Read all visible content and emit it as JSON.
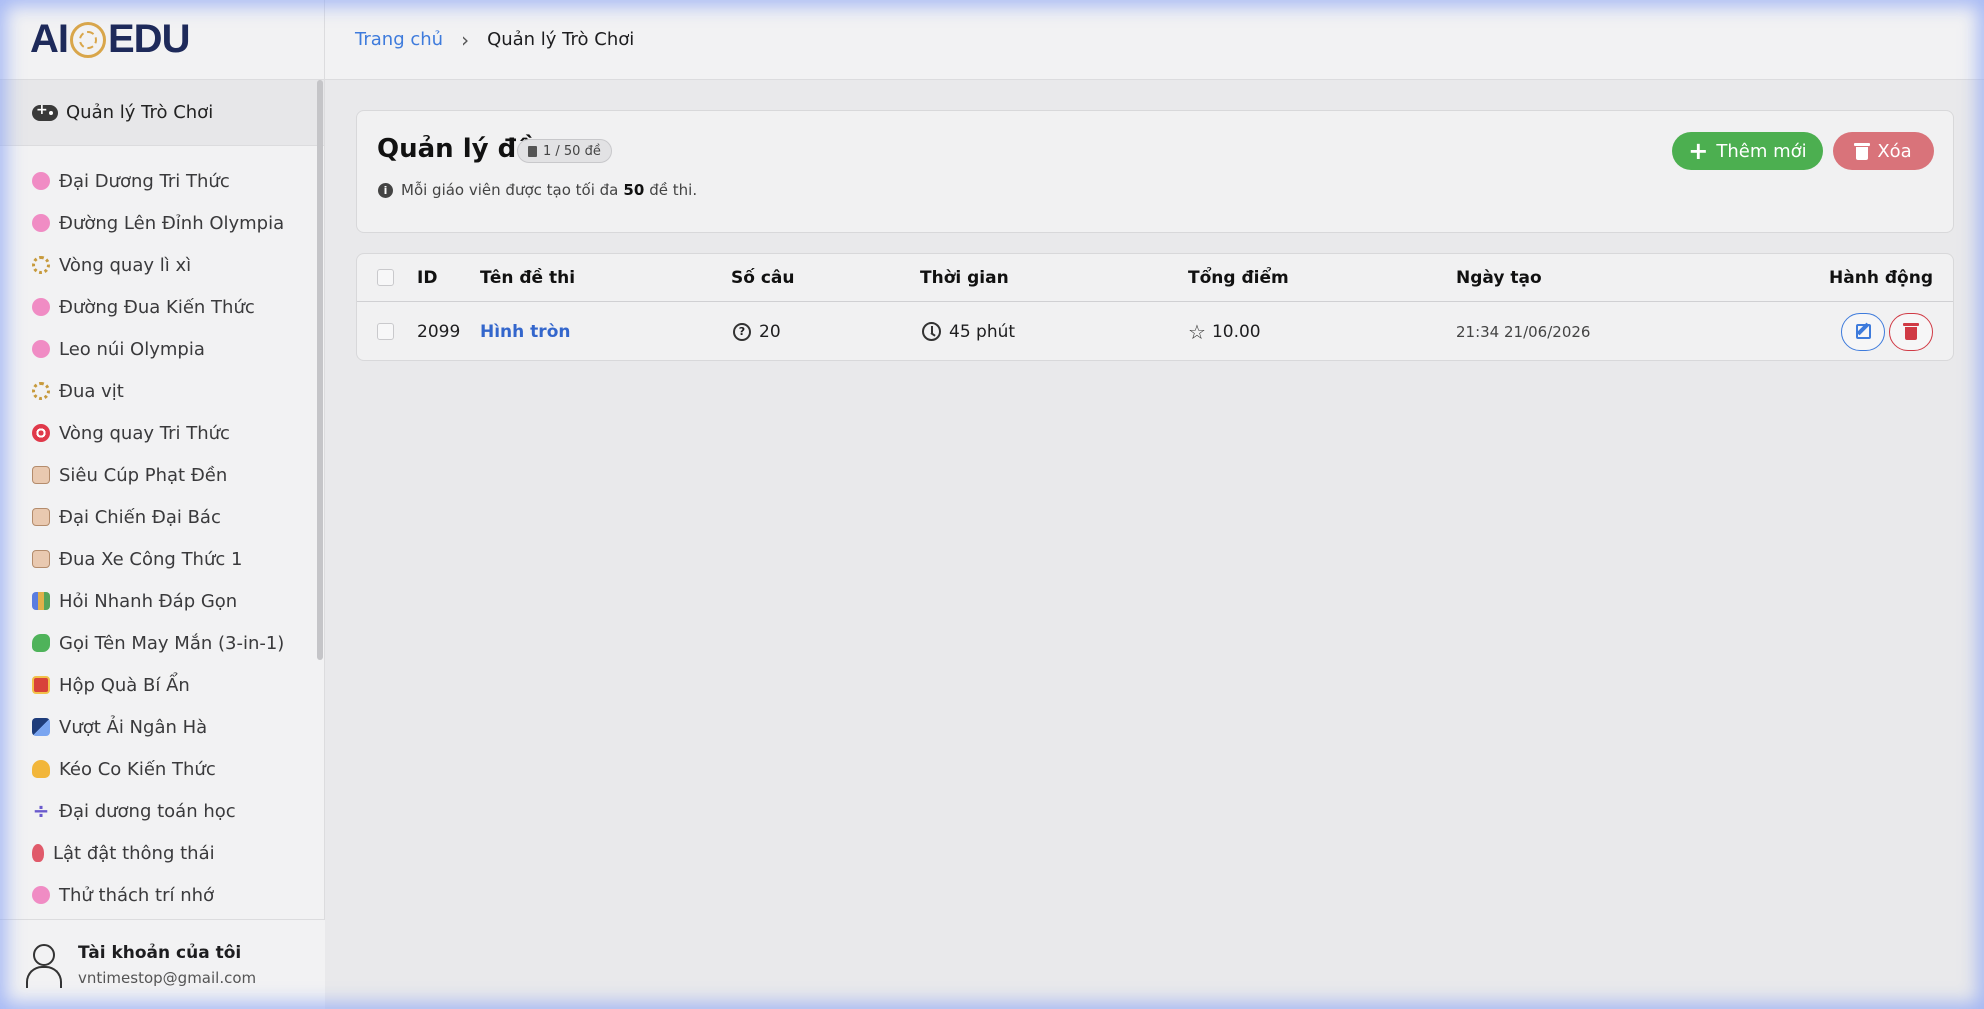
{
  "brand": {
    "logo_left": "AI",
    "logo_right": "EDU"
  },
  "breadcrumb": {
    "home": "Trang chủ",
    "separator": "›",
    "current": "Quản lý Trò Chơi"
  },
  "sidebar": {
    "section_label": "Quản lý Trò Chơi",
    "items": [
      {
        "label": "Đại Dương Tri Thức",
        "icon": "brain-icon"
      },
      {
        "label": "Đường Lên Đỉnh Olympia",
        "icon": "brain-icon"
      },
      {
        "label": "Vòng quay lì xì",
        "icon": "wheel-icon"
      },
      {
        "label": "Đường Đua Kiến Thức",
        "icon": "brain-icon"
      },
      {
        "label": "Leo núi Olympia",
        "icon": "brain-icon"
      },
      {
        "label": "Đua vịt",
        "icon": "wheel-icon"
      },
      {
        "label": "Vòng quay Tri Thức",
        "icon": "target-icon"
      },
      {
        "label": "Siêu Cúp Phạt Đền",
        "icon": "note-icon"
      },
      {
        "label": "Đại Chiến Đại Bác",
        "icon": "note-icon"
      },
      {
        "label": "Đua Xe Công Thức 1",
        "icon": "note-icon"
      },
      {
        "label": "Hỏi Nhanh Đáp Gọn",
        "icon": "books-icon"
      },
      {
        "label": "Gọi Tên May Mắn (3-in-1)",
        "icon": "dino-icon"
      },
      {
        "label": "Hộp Quà Bí Ẩn",
        "icon": "gift-icon"
      },
      {
        "label": "Vượt Ải Ngân Hà",
        "icon": "space-icon"
      },
      {
        "label": "Kéo Co Kiến Thức",
        "icon": "muscle-icon"
      },
      {
        "label": "Đại dương toán học",
        "icon": "divide-icon"
      },
      {
        "label": "Lật đật thông thái",
        "icon": "doll-icon"
      },
      {
        "label": "Thử thách trí nhớ",
        "icon": "brain-icon"
      }
    ],
    "account": {
      "title": "Tài khoản của tôi",
      "email": "vntimestop@gmail.com"
    }
  },
  "header": {
    "title": "Quản lý đề",
    "badge": "1 / 50 đề",
    "note_prefix": "Mỗi giáo viên được tạo tối đa",
    "note_value": "50",
    "note_suffix": "đề thi.",
    "add_label": "Thêm mới",
    "delete_label": "Xóa"
  },
  "table": {
    "columns": [
      "ID",
      "Tên đề thi",
      "Số câu",
      "Thời gian",
      "Tổng điểm",
      "Ngày tạo",
      "Hành động"
    ],
    "rows": [
      {
        "id": "2099",
        "name": "Hình tròn",
        "questions": "20",
        "time": "45 phút",
        "score": "10.00",
        "created": "21:34 21/06/2026"
      }
    ]
  },
  "colors": {
    "add": "#4caf50",
    "delete": "#d9737a",
    "link": "#3e7bdc"
  }
}
